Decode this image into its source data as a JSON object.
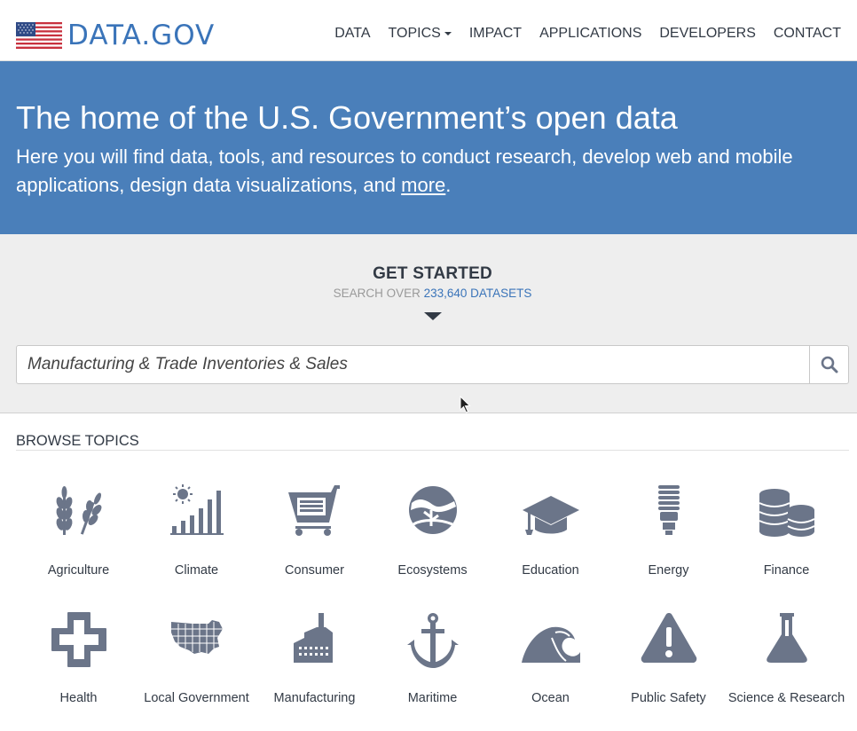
{
  "header": {
    "logo_text": "DATA.GOV",
    "nav": [
      {
        "label": "DATA"
      },
      {
        "label": "TOPICS"
      },
      {
        "label": "IMPACT"
      },
      {
        "label": "APPLICATIONS"
      },
      {
        "label": "DEVELOPERS"
      },
      {
        "label": "CONTACT"
      }
    ]
  },
  "hero": {
    "title": "The home of the U.S. Government’s open data",
    "subtitle_prefix": "Here you will find data, tools, and resources to conduct research, develop web and mobile applications, design data visualizations, and ",
    "subtitle_link": "more",
    "subtitle_suffix": "."
  },
  "get_started": {
    "title": "GET STARTED",
    "subtitle_prefix": "SEARCH OVER ",
    "dataset_count_label": "233,640 DATASETS",
    "search": {
      "value": "Manufacturing & Trade Inventories & Sales"
    }
  },
  "browse": {
    "title": "BROWSE TOPICS",
    "topics": [
      {
        "label": "Agriculture",
        "icon": "wheat-icon"
      },
      {
        "label": "Climate",
        "icon": "sun-bar-chart-icon"
      },
      {
        "label": "Consumer",
        "icon": "shopping-cart-icon"
      },
      {
        "label": "Ecosystems",
        "icon": "globe-tree-icon"
      },
      {
        "label": "Education",
        "icon": "graduation-cap-icon"
      },
      {
        "label": "Energy",
        "icon": "lightbulb-icon"
      },
      {
        "label": "Finance",
        "icon": "coins-icon"
      },
      {
        "label": "Health",
        "icon": "cross-icon"
      },
      {
        "label": "Local Government",
        "icon": "us-map-icon"
      },
      {
        "label": "Manufacturing",
        "icon": "factory-icon"
      },
      {
        "label": "Maritime",
        "icon": "anchor-icon"
      },
      {
        "label": "Ocean",
        "icon": "wave-icon"
      },
      {
        "label": "Public Safety",
        "icon": "warning-icon"
      },
      {
        "label": "Science & Research",
        "icon": "flask-icon"
      }
    ]
  },
  "colors": {
    "brand_blue": "#3a74b9",
    "hero_bg": "#4a7fba",
    "icon_gray": "#6b7589",
    "text": "#323a45"
  }
}
